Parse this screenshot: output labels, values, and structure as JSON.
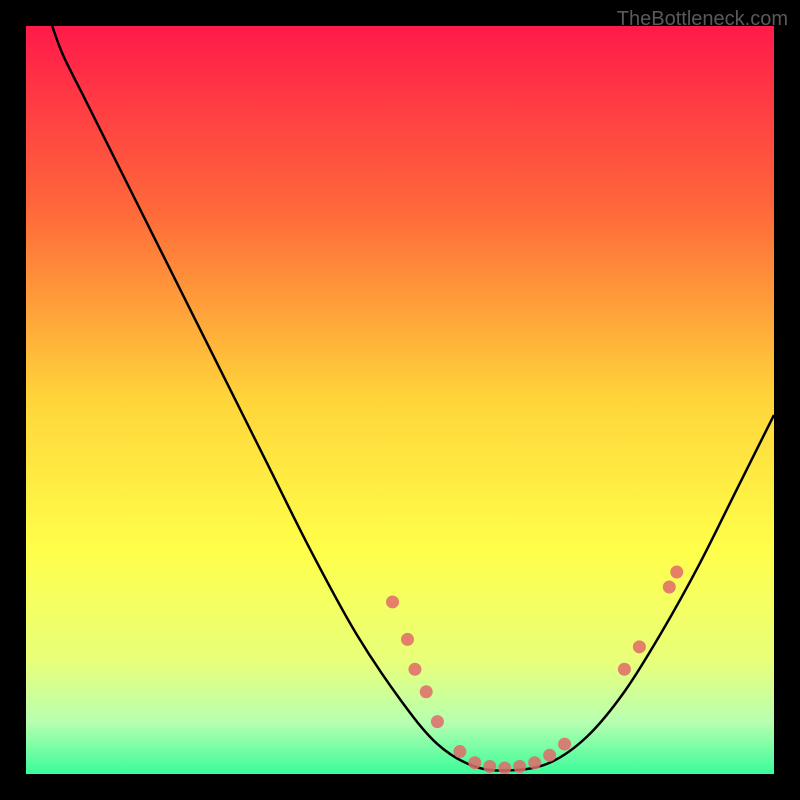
{
  "watermark": "TheBottleneck.com",
  "chart_data": {
    "type": "line",
    "title": "",
    "xlabel": "",
    "ylabel": "",
    "xlim": [
      0,
      100
    ],
    "ylim": [
      0,
      100
    ],
    "gradient_stops": [
      {
        "offset": 0,
        "color": "#ff1a4a"
      },
      {
        "offset": 25,
        "color": "#ff6a3a"
      },
      {
        "offset": 50,
        "color": "#ffd53a"
      },
      {
        "offset": 70,
        "color": "#ffff4a"
      },
      {
        "offset": 85,
        "color": "#e8ff7a"
      },
      {
        "offset": 93,
        "color": "#b8ffb0"
      },
      {
        "offset": 100,
        "color": "#3afc9a"
      }
    ],
    "curve": [
      {
        "x": 3.5,
        "y": 100
      },
      {
        "x": 5,
        "y": 96
      },
      {
        "x": 8,
        "y": 90
      },
      {
        "x": 12,
        "y": 82
      },
      {
        "x": 18,
        "y": 70
      },
      {
        "x": 25,
        "y": 56
      },
      {
        "x": 32,
        "y": 42
      },
      {
        "x": 38,
        "y": 30
      },
      {
        "x": 44,
        "y": 19
      },
      {
        "x": 50,
        "y": 10
      },
      {
        "x": 55,
        "y": 4
      },
      {
        "x": 60,
        "y": 1
      },
      {
        "x": 65,
        "y": 0.5
      },
      {
        "x": 70,
        "y": 1.5
      },
      {
        "x": 75,
        "y": 5
      },
      {
        "x": 80,
        "y": 11
      },
      {
        "x": 85,
        "y": 19
      },
      {
        "x": 90,
        "y": 28
      },
      {
        "x": 95,
        "y": 38
      },
      {
        "x": 100,
        "y": 48
      }
    ],
    "points": [
      {
        "x": 49,
        "y": 23
      },
      {
        "x": 51,
        "y": 18
      },
      {
        "x": 52,
        "y": 14
      },
      {
        "x": 53.5,
        "y": 11
      },
      {
        "x": 55,
        "y": 7
      },
      {
        "x": 58,
        "y": 3
      },
      {
        "x": 60,
        "y": 1.5
      },
      {
        "x": 62,
        "y": 1
      },
      {
        "x": 64,
        "y": 0.8
      },
      {
        "x": 66,
        "y": 1
      },
      {
        "x": 68,
        "y": 1.5
      },
      {
        "x": 70,
        "y": 2.5
      },
      {
        "x": 72,
        "y": 4
      },
      {
        "x": 80,
        "y": 14
      },
      {
        "x": 82,
        "y": 17
      },
      {
        "x": 86,
        "y": 25
      },
      {
        "x": 87,
        "y": 27
      }
    ]
  }
}
